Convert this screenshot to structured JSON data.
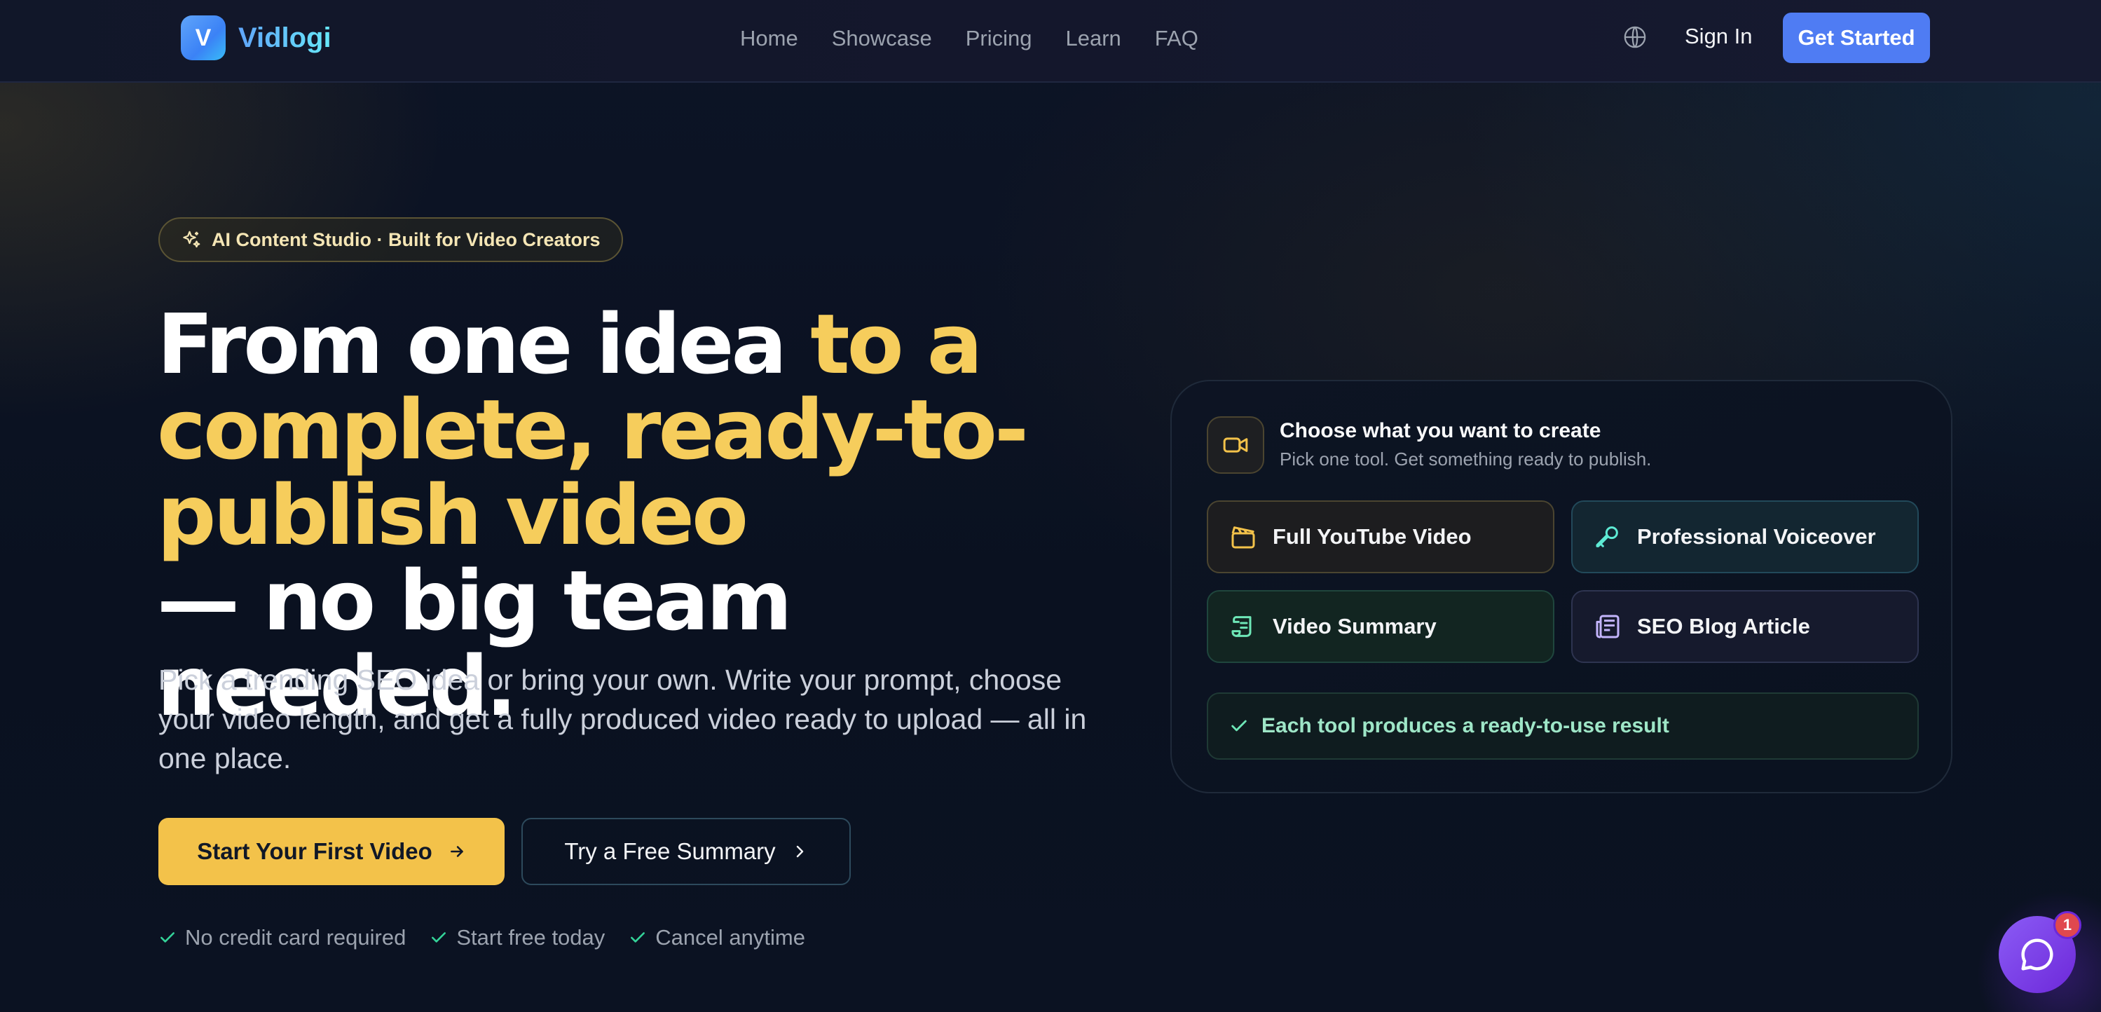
{
  "nav": {
    "logo_letter": "V",
    "brand": "Vidlogi",
    "links": [
      "Home",
      "Showcase",
      "Pricing",
      "Learn",
      "FAQ"
    ],
    "sign_in": "Sign In",
    "get_started": "Get Started"
  },
  "hero": {
    "pill": "AI Content Studio · Built for Video Creators",
    "headline_white_1": "From one idea ",
    "headline_gold": "to a complete, ready-to-publish video",
    "headline_white_2": "— no big team needed.",
    "subtitle": "Pick a trending SEO idea or bring your own. Write your prompt, choose your video length, and get a fully produced video ready to upload — all in one place.",
    "primary_cta": "Start Your First Video",
    "secondary_cta": "Try a Free Summary",
    "perks": [
      "No credit card required",
      "Start free today",
      "Cancel anytime"
    ]
  },
  "card": {
    "title": "Choose what you want to create",
    "subtitle": "Pick one tool. Get something ready to publish.",
    "tools": [
      "Full YouTube Video",
      "Professional Voiceover",
      "Video Summary",
      "SEO Blog Article"
    ],
    "result": "Each tool produces a ready-to-use result"
  },
  "chat": {
    "badge_count": "1"
  },
  "colors": {
    "accent_gold": "#f6cd5c",
    "primary_blue": "#4f7cf3",
    "chat_purple": "#7c3aed"
  }
}
